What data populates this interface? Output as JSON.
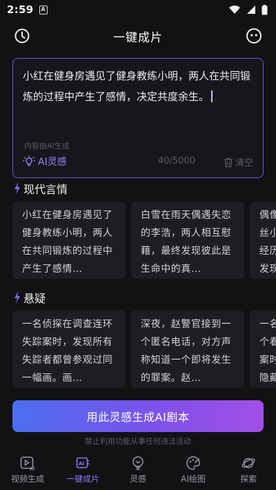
{
  "status": {
    "time": "2:59"
  },
  "header": {
    "title": "一键成片"
  },
  "editor": {
    "text": "小红在健身房遇见了健身教练小明，两人在共同锻炼的过程中产生了感情，决定共度余生。",
    "ai_note": "内容由AI生成",
    "inspire_label": "AI灵感",
    "counter": "40/5000",
    "clear_label": "清空"
  },
  "sections": [
    {
      "title": "现代言情",
      "cards": [
        "小红在健身房遇见了健身教练小明，两人在共同锻炼的过程中产生了感情…",
        "白雪在雨天偶遇失恋的李浩，两人相互慰藉，最终发现彼此是生命中的真…",
        "偶像丝小经历发现"
      ]
    },
    {
      "title": "悬疑",
      "cards": [
        "一名侦探在调查连环失踪案时，发现所有失踪者都曾参观过同一幅画。画…",
        "深夜，赵警官接到一个匿名电话，对方声称知道一个即将发生的罪案。赵…",
        "一名个看案时隐藏"
      ]
    }
  ],
  "generate_label": "用此灵感生成AI剧本",
  "disclaimer": "禁止利用功能从事任何违法活动",
  "tabs": [
    {
      "label": "视频生成",
      "icon": "video-ai-icon"
    },
    {
      "label": "一键成片",
      "icon": "ai-chip-icon",
      "active": true
    },
    {
      "label": "灵感",
      "icon": "lightbulb-icon"
    },
    {
      "label": "AI绘图",
      "icon": "palette-icon"
    },
    {
      "label": "探索",
      "icon": "planet-icon"
    }
  ],
  "colors": {
    "accent": "#8a7cf6",
    "background": "#121214",
    "card": "#1e1e22"
  }
}
